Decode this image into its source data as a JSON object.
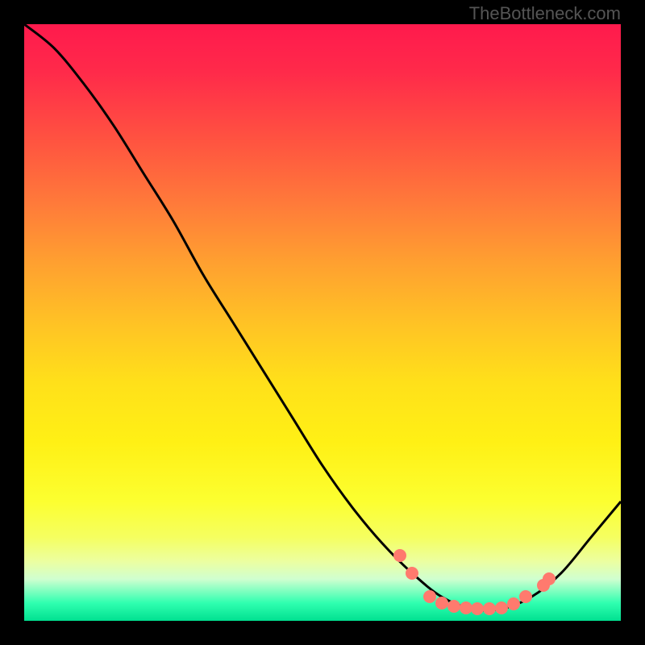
{
  "watermark": "TheBottleneck.com",
  "colors": {
    "curve_stroke": "#000000",
    "dot_fill": "#ff7a6e"
  },
  "chart_data": {
    "type": "line",
    "title": "",
    "xlabel": "",
    "ylabel": "",
    "xlim": [
      0,
      100
    ],
    "ylim": [
      0,
      100
    ],
    "curve": [
      {
        "x": 0,
        "y": 100
      },
      {
        "x": 5,
        "y": 96
      },
      {
        "x": 10,
        "y": 90
      },
      {
        "x": 15,
        "y": 83
      },
      {
        "x": 20,
        "y": 75
      },
      {
        "x": 25,
        "y": 67
      },
      {
        "x": 30,
        "y": 58
      },
      {
        "x": 35,
        "y": 50
      },
      {
        "x": 40,
        "y": 42
      },
      {
        "x": 45,
        "y": 34
      },
      {
        "x": 50,
        "y": 26
      },
      {
        "x": 55,
        "y": 19
      },
      {
        "x": 60,
        "y": 13
      },
      {
        "x": 65,
        "y": 8
      },
      {
        "x": 70,
        "y": 4
      },
      {
        "x": 75,
        "y": 2
      },
      {
        "x": 80,
        "y": 2
      },
      {
        "x": 85,
        "y": 4
      },
      {
        "x": 90,
        "y": 8
      },
      {
        "x": 95,
        "y": 14
      },
      {
        "x": 100,
        "y": 20
      }
    ],
    "highlight_points": [
      {
        "x": 63,
        "y": 11
      },
      {
        "x": 65,
        "y": 8
      },
      {
        "x": 68,
        "y": 4
      },
      {
        "x": 70,
        "y": 3
      },
      {
        "x": 72,
        "y": 2.5
      },
      {
        "x": 74,
        "y": 2.2
      },
      {
        "x": 76,
        "y": 2
      },
      {
        "x": 78,
        "y": 2
      },
      {
        "x": 80,
        "y": 2.2
      },
      {
        "x": 82,
        "y": 2.8
      },
      {
        "x": 84,
        "y": 4
      },
      {
        "x": 87,
        "y": 6
      },
      {
        "x": 88,
        "y": 7
      }
    ]
  }
}
